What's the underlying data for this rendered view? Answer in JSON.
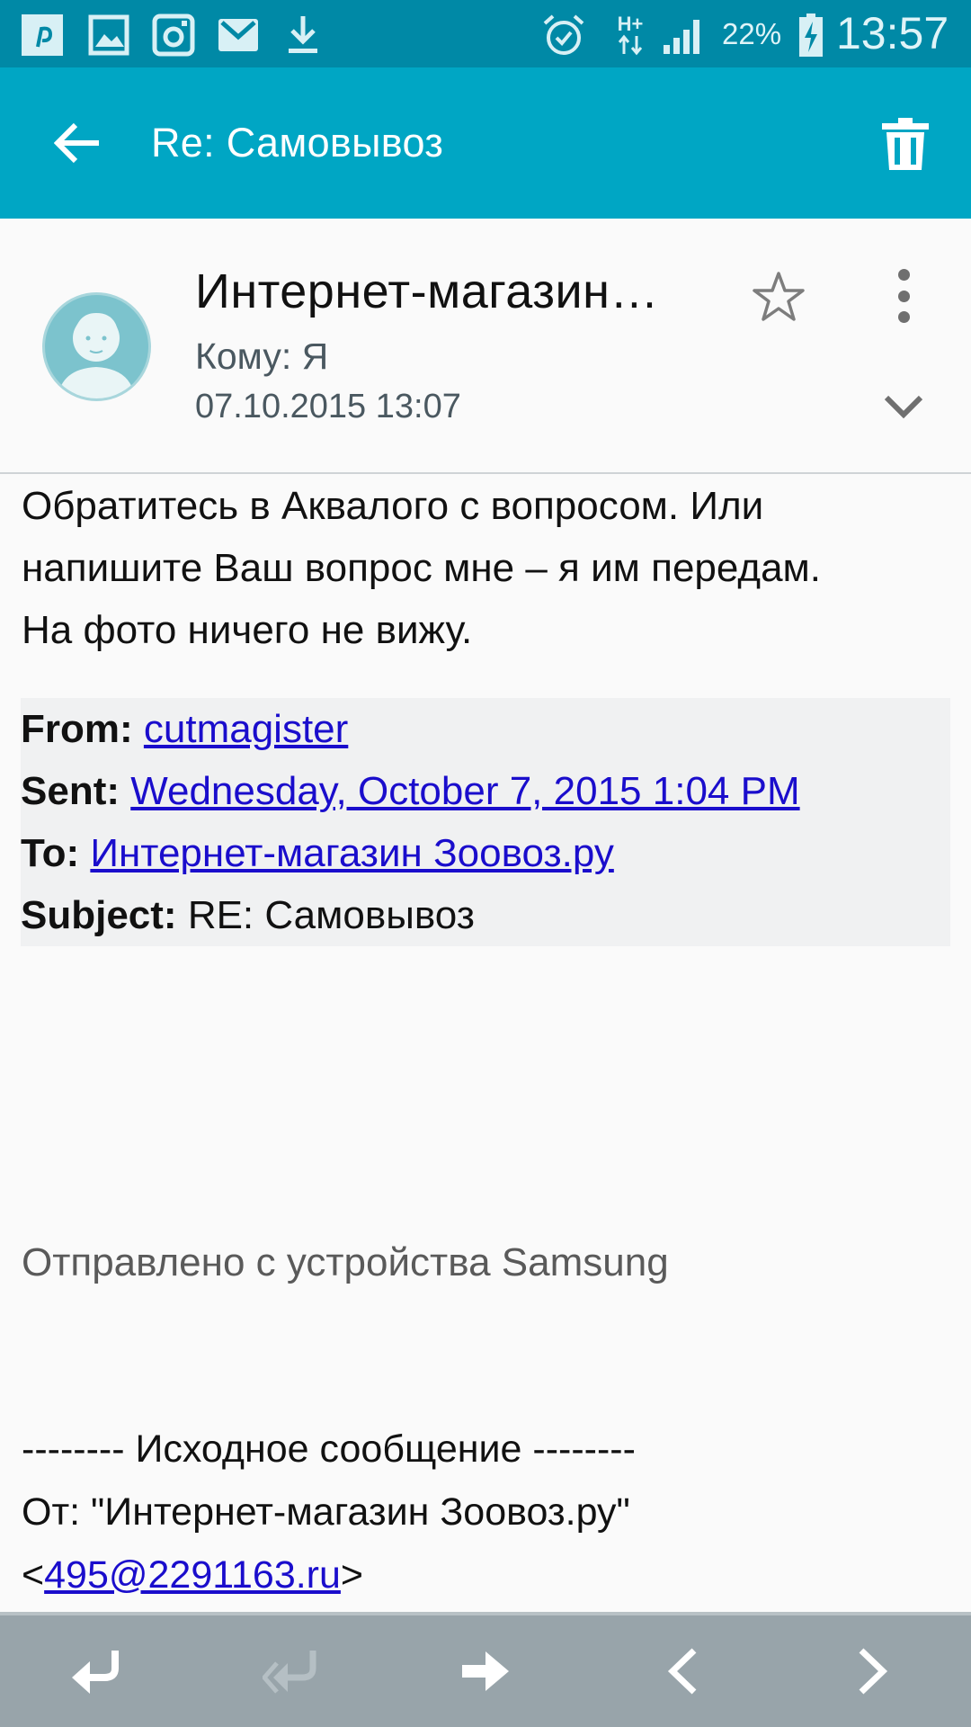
{
  "status_bar": {
    "battery": "22%",
    "time": "13:57",
    "network": "H+",
    "icons": [
      "pinterest-icon",
      "gallery-icon",
      "instagram-icon",
      "gmail-icon",
      "download-icon",
      "alarm-icon",
      "data-arrows-icon",
      "signal-icon",
      "battery-charging-icon"
    ]
  },
  "app_bar": {
    "title": "Re: Самовывоз",
    "back_icon": "arrow-back-icon",
    "delete_icon": "trash-icon"
  },
  "header": {
    "sender": "Интернет-магазин…",
    "recipient": "Кому: Я",
    "date": "07.10.2015  13:07"
  },
  "body": {
    "line1": "Обратитесь в Аквалого с вопросом. Или",
    "line2": "напишите Ваш вопрос мне – я им передам.",
    "line3": "На фото ничего не вижу."
  },
  "quote": {
    "from_label": "From:",
    "from_value": "cutmagister",
    "sent_label": "Sent:",
    "sent_value": "Wednesday, October 7, 2015 1:04 PM",
    "to_label": "To:",
    "to_value": "Интернет-магазин Зоовоз.ру",
    "subject_label": "Subject:",
    "subject_value": "RE: Самовывоз"
  },
  "signature": "Отправлено с устройства Samsung",
  "original": {
    "divider": "-------- Исходное сообщение --------",
    "from_line": "От: \"Интернет-магазин Зоовоз.ру\"",
    "email_open": "<",
    "email": "495@2291163.ru",
    "email_close": ">"
  },
  "bottom_bar": {
    "icons": [
      "reply-icon",
      "reply-all-icon",
      "forward-icon",
      "previous-icon",
      "next-icon"
    ]
  },
  "colors": {
    "status_bar": "#0089a6",
    "app_bar": "#00a6c4",
    "link": "#1a0dcc",
    "bottom_bar": "#98a4aa"
  }
}
